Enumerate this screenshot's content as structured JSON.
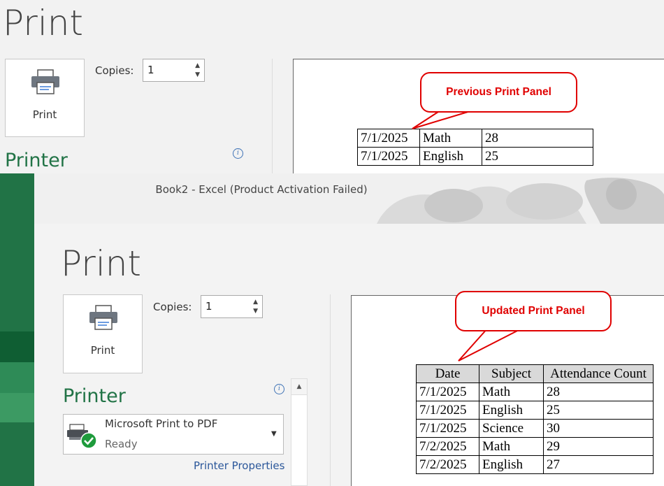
{
  "previous_panel": {
    "heading": "Print",
    "print_button_label": "Print",
    "copies_label": "Copies:",
    "copies_value": "1",
    "printer_heading": "Printer",
    "callout": "Previous Print Panel",
    "table_rows": [
      [
        "7/1/2025",
        "Math",
        "28"
      ],
      [
        "7/1/2025",
        "English",
        "25"
      ]
    ]
  },
  "window": {
    "title": "Book2  -  Excel (Product Activation Failed)",
    "heading": "Print",
    "print_button_label": "Print",
    "copies_label": "Copies:",
    "copies_value": "1",
    "printer_heading": "Printer",
    "printer_name": "Microsoft Print to PDF",
    "printer_status": "Ready",
    "printer_properties_link": "Printer Properties",
    "callout": "Updated Print Panel",
    "table_headers": [
      "Date",
      "Subject",
      "Attendance Count"
    ],
    "table_rows": [
      [
        "7/1/2025",
        "Math",
        "28"
      ],
      [
        "7/1/2025",
        "English",
        "25"
      ],
      [
        "7/1/2025",
        "Science",
        "30"
      ],
      [
        "7/2/2025",
        "Math",
        "29"
      ],
      [
        "7/2/2025",
        "English",
        "27"
      ]
    ]
  },
  "icons": {
    "printer": "printer-icon",
    "spin_up": "chevron-up-icon",
    "spin_down": "chevron-down-icon",
    "info": "info-icon",
    "printer_ready": "printer-ready-icon",
    "dropdown": "dropdown-arrow-icon"
  },
  "colors": {
    "excel_green": "#217346",
    "callout_red": "#e00000",
    "link_blue": "#2b579a",
    "header_fill": "#d9d9d9"
  }
}
